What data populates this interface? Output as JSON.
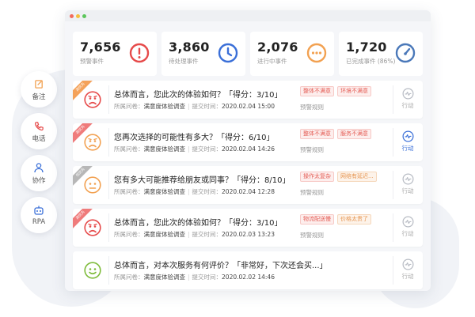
{
  "colors": {
    "red": "#e64a4a",
    "blue": "#3a6fd8",
    "orange": "#f2a151",
    "steel": "#4a78b9",
    "green": "#7dbb3a",
    "ribbon_orange": "#f4a25a",
    "ribbon_red": "#ef7b7b",
    "ribbon_gray": "#b7b7b7"
  },
  "side_menu": [
    {
      "label": "备注",
      "icon": "edit-note-icon"
    },
    {
      "label": "电话",
      "icon": "phone-icon"
    },
    {
      "label": "协作",
      "icon": "collaborate-user-icon"
    },
    {
      "label": "RPA",
      "icon": "robot-icon"
    }
  ],
  "stats": [
    {
      "value": "7,656",
      "label": "预警事件",
      "icon": "alert-circle-icon"
    },
    {
      "value": "3,860",
      "label": "待处理事件",
      "icon": "clock-icon"
    },
    {
      "value": "2,076",
      "label": "进行中事件",
      "icon": "ellipsis-circle-icon"
    },
    {
      "value": "1,720",
      "label": "已完成事件 (86%)",
      "icon": "gauge-icon"
    }
  ],
  "cards": [
    {
      "ribbon": "高优先",
      "ribbon_color": "ribbon_orange",
      "face": "sad",
      "face_color": "red",
      "question": "总体而言，您此次的体验如何？「得分：3/10」",
      "survey_label": "所属问卷：",
      "survey": "满意度体验调查",
      "time_label": "提交时间：",
      "time": "2020.02.04 15:00",
      "tags": [
        {
          "text": "整体不满意",
          "style": "red"
        },
        {
          "text": "环境不满意",
          "style": "red"
        }
      ],
      "rule": "预警规则",
      "action": "行动",
      "action_active": false
    },
    {
      "ribbon": "高优先",
      "ribbon_color": "ribbon_red",
      "face": "sad",
      "face_color": "orange",
      "question": "您再次选择的可能性有多大？「得分：6/10」",
      "survey_label": "所属问卷：",
      "survey": "满意度体验调查",
      "time_label": "提交时间：",
      "time": "2020.02.04 14:26",
      "tags": [
        {
          "text": "整体不满意",
          "style": "red"
        },
        {
          "text": "服务不满意",
          "style": "red"
        }
      ],
      "rule": "预警规则",
      "action": "行动",
      "action_active": true
    },
    {
      "ribbon": "低优先",
      "ribbon_color": "ribbon_gray",
      "face": "neutral",
      "face_color": "orange",
      "question": "您有多大可能推荐给朋友或同事？「得分：8/10」",
      "survey_label": "所属问卷：",
      "survey": "满意度体验调查",
      "time_label": "提交时间：",
      "time": "2020.02.04 12:28",
      "tags": [
        {
          "text": "操作太复杂",
          "style": "red"
        },
        {
          "text": "网络有延迟...",
          "style": "orange"
        }
      ],
      "rule": "预警规则",
      "action": "行动",
      "action_active": false
    },
    {
      "ribbon": "高优先",
      "ribbon_color": "ribbon_red",
      "face": "sad",
      "face_color": "red",
      "question": "总体而言，您此次的体验如何？「得分：3/10」",
      "survey_label": "所属问卷：",
      "survey": "满意度体验调查",
      "time_label": "提交时间：",
      "time": "2020.02.03 13:23",
      "tags": [
        {
          "text": "物流配送慢",
          "style": "red"
        },
        {
          "text": "价格太贵了",
          "style": "orange"
        }
      ],
      "rule": "预警规则",
      "action": "行动",
      "action_active": false
    },
    {
      "ribbon": "",
      "ribbon_color": "",
      "face": "happy",
      "face_color": "green",
      "question": "总体而言，对本次服务有何评价？「非常好，下次还会买...」",
      "survey_label": "所属问卷：",
      "survey": "满意度体验调查",
      "time_label": "提交时间：",
      "time": "2020.02.02 14:46",
      "tags": [],
      "rule": "",
      "action": "行动",
      "action_active": false
    }
  ]
}
